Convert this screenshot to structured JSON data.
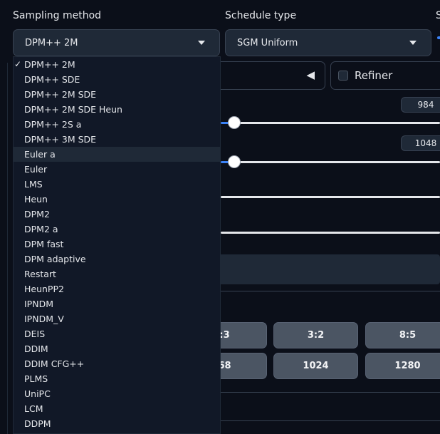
{
  "sampling": {
    "label": "Sampling method",
    "value": "DPM++ 2M",
    "options": [
      "DPM++ 2M",
      "DPM++ SDE",
      "DPM++ 2M SDE",
      "DPM++ 2M SDE Heun",
      "DPM++ 2S a",
      "DPM++ 3M SDE",
      "Euler a",
      "Euler",
      "LMS",
      "Heun",
      "DPM2",
      "DPM2 a",
      "DPM fast",
      "DPM adaptive",
      "Restart",
      "HeunPP2",
      "IPNDM",
      "IPNDM_V",
      "DEIS",
      "DDIM",
      "DDIM CFG++",
      "PLMS",
      "UniPC",
      "LCM",
      "DDPM"
    ],
    "selected_index": 0,
    "hover_index": 6,
    "checkmark": "✓"
  },
  "schedule": {
    "label": "Schedule type",
    "value": "SGM Uniform",
    "next_label_partial": "S"
  },
  "refiner": {
    "label": "Refiner",
    "checked": false,
    "collapse_icon": "◀"
  },
  "width_slider": {
    "value": "984"
  },
  "height_slider": {
    "value": "1048"
  },
  "resolution_buttons": {
    "row1": [
      ":3",
      "3:2",
      "8:5"
    ],
    "row2": [
      "68",
      "1024",
      "1280"
    ]
  }
}
